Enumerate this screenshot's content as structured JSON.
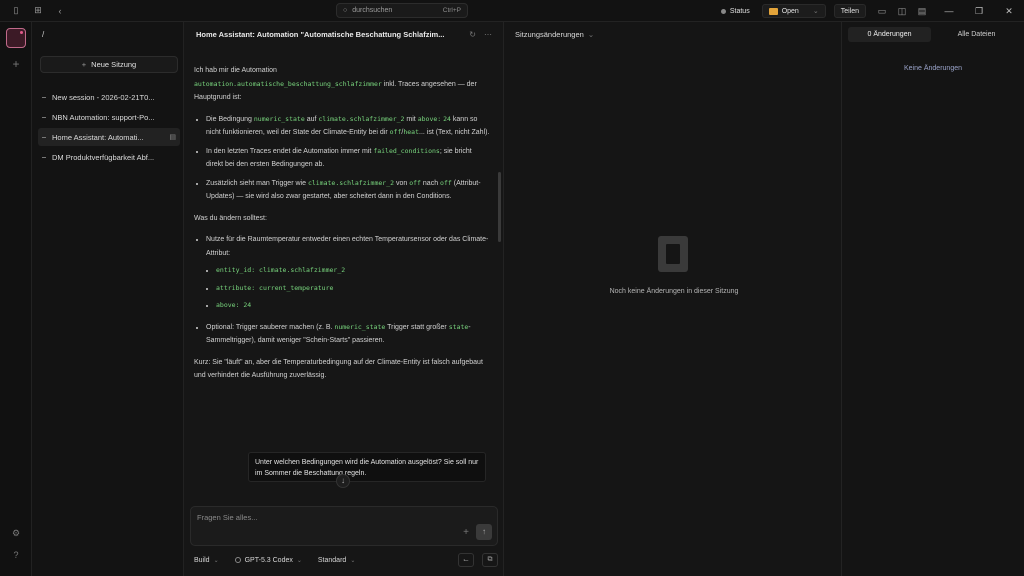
{
  "titlebar": {
    "search_placeholder": "durchsuchen",
    "search_shortcut": "Ctrl+P",
    "status_label": "Status",
    "open_label": "Open",
    "share_label": "Teilen"
  },
  "sessions": {
    "path": "/",
    "new_session_label": "Neue Sitzung",
    "items": [
      {
        "label": "New session - 2026-02-21T0..."
      },
      {
        "label": "NBN Automation: support-Po..."
      },
      {
        "label": "Home Assistant: Automati..."
      },
      {
        "label": "DM Produktverfügbarkeit Abf..."
      }
    ]
  },
  "chat": {
    "title": "Home Assistant: Automation \"Automatische Beschattung Schlafzim...",
    "intro_1": "Ich hab mir die Automation",
    "intro_code": "automation.automatische_beschattung_schlafzimmer",
    "intro_2": " inkl. Traces angesehen — der Hauptgrund ist:",
    "b1_1": "Die Bedingung ",
    "b1_c1": "numeric_state",
    "b1_2": " auf ",
    "b1_c2": "climate.schlafzimmer_2",
    "b1_3": " mit ",
    "b1_c3": "above:",
    "b1_c4": "24",
    "b1_4": " kann so nicht funktionieren, weil der State der Climate-Entity bei dir ",
    "b1_c5": "off",
    "b1_5": "/",
    "b1_c6": "heat",
    "b1_6": "... ist (Text, nicht Zahl).",
    "b2_1": "In den letzten Traces endet die Automation immer mit ",
    "b2_c1": "failed_conditions",
    "b2_2": "; sie bricht direkt bei den ersten Bedingungen ab.",
    "b3_1": "Zusätzlich sieht man Trigger wie ",
    "b3_c1": "climate.schlafzimmer_2",
    "b3_2": " von ",
    "b3_c2": "off",
    "b3_3": " nach ",
    "b3_c3": "off",
    "b3_4": " (Attribut-Updates) — sie wird also zwar gestartet, aber scheitert dann in den Conditions.",
    "change_heading": "Was du ändern solltest:",
    "c1_text": "Nutze für die Raumtemperatur entweder einen echten Temperatursensor oder das Climate-Attribut:",
    "c1_sub": [
      "entity_id: climate.schlafzimmer_2",
      "attribute: current_temperature",
      "above: 24"
    ],
    "c2_1": "Optional: Trigger sauberer machen (z. B. ",
    "c2_c1": "numeric_state",
    "c2_2": " Trigger statt großer ",
    "c2_c2": "state",
    "c2_3": "-Sammeltrigger), damit weniger \"Schein-Starts\" passieren.",
    "summary": "Kurz: Sie \"läuft\" an, aber die Temperaturbedingung auf der Climate-Entity ist falsch aufgebaut und verhindert die Ausführung zuverlässig.",
    "suggestion": "Unter welchen Bedingungen wird die Automation ausgelöst? Sie soll nur im Sommer die Beschattung regeln.",
    "composer_placeholder": "Fragen Sie alles...",
    "mode_label": "Build",
    "model_label": "GPT-5.3 Codex",
    "variant_label": "Standard"
  },
  "changes": {
    "title": "Sitzungsänderungen",
    "empty_text": "Noch keine Änderungen in dieser Sitzung"
  },
  "right_panel": {
    "tab_changes": "0 Änderungen",
    "tab_all_files": "Alle Dateien",
    "no_changes": "Keine Änderungen"
  }
}
